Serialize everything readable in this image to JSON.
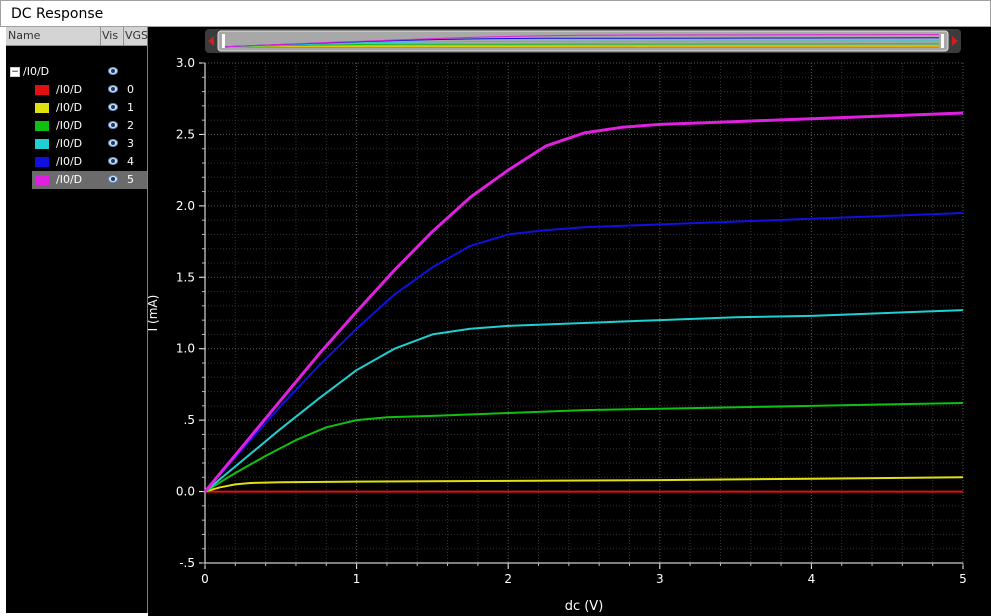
{
  "window": {
    "title": "DC Response"
  },
  "panel": {
    "columns": [
      "Name",
      "Vis",
      "VGS"
    ],
    "parent": {
      "label": "/I0/D"
    },
    "rows": [
      {
        "label": "/I0/D",
        "vgs": "0",
        "color": "#e01010"
      },
      {
        "label": "/I0/D",
        "vgs": "1",
        "color": "#e0e010"
      },
      {
        "label": "/I0/D",
        "vgs": "2",
        "color": "#10c010"
      },
      {
        "label": "/I0/D",
        "vgs": "3",
        "color": "#20d0d0"
      },
      {
        "label": "/I0/D",
        "vgs": "4",
        "color": "#1010e0"
      },
      {
        "label": "/I0/D",
        "vgs": "5",
        "color": "#e020e0"
      }
    ],
    "selected_row": 5
  },
  "chart_data": {
    "type": "line",
    "xlabel": "dc (V)",
    "ylabel": "I (mA)",
    "xlim": [
      0,
      5
    ],
    "ylim": [
      -0.5,
      3.0
    ],
    "xticks": [
      "0",
      "1",
      "2",
      "3",
      "4",
      "5"
    ],
    "yticks": [
      "-.5",
      "0.0",
      ".5",
      "1.0",
      "1.5",
      "2.0",
      "2.5",
      "3.0"
    ],
    "ytick_values": [
      -0.5,
      0,
      0.5,
      1.0,
      1.5,
      2.0,
      2.5,
      3.0
    ],
    "grid": true,
    "series": [
      {
        "name": "0",
        "color": "#e01010",
        "x": [
          0,
          1,
          2,
          3,
          4,
          5
        ],
        "y": [
          0,
          0,
          0,
          0,
          0,
          0
        ]
      },
      {
        "name": "1",
        "color": "#e0e010",
        "x": [
          0,
          0.1,
          0.2,
          0.3,
          0.5,
          1,
          2,
          3,
          4,
          5
        ],
        "y": [
          0,
          0.03,
          0.05,
          0.06,
          0.065,
          0.07,
          0.075,
          0.08,
          0.09,
          0.1
        ]
      },
      {
        "name": "2",
        "color": "#10c010",
        "x": [
          0,
          0.2,
          0.4,
          0.6,
          0.8,
          1.0,
          1.2,
          1.5,
          2,
          2.5,
          3,
          3.5,
          4,
          4.5,
          5
        ],
        "y": [
          0,
          0.13,
          0.25,
          0.36,
          0.45,
          0.5,
          0.52,
          0.53,
          0.55,
          0.57,
          0.58,
          0.59,
          0.6,
          0.61,
          0.62
        ]
      },
      {
        "name": "3",
        "color": "#20d0d0",
        "x": [
          0,
          0.25,
          0.5,
          0.75,
          1.0,
          1.25,
          1.5,
          1.75,
          2,
          2.5,
          3,
          3.5,
          4,
          4.5,
          5
        ],
        "y": [
          0,
          0.22,
          0.44,
          0.65,
          0.85,
          1.0,
          1.1,
          1.14,
          1.16,
          1.18,
          1.2,
          1.22,
          1.23,
          1.25,
          1.27
        ]
      },
      {
        "name": "4",
        "color": "#1010e0",
        "x": [
          0,
          0.25,
          0.5,
          0.75,
          1.0,
          1.25,
          1.5,
          1.75,
          2.0,
          2.25,
          2.5,
          3,
          3.5,
          4,
          4.5,
          5
        ],
        "y": [
          0,
          0.3,
          0.6,
          0.88,
          1.14,
          1.38,
          1.57,
          1.72,
          1.8,
          1.83,
          1.85,
          1.87,
          1.89,
          1.91,
          1.93,
          1.95
        ]
      },
      {
        "name": "5",
        "color": "#e020e0",
        "x": [
          0,
          0.25,
          0.5,
          0.75,
          1.0,
          1.25,
          1.5,
          1.75,
          2.0,
          2.25,
          2.5,
          2.75,
          3,
          3.5,
          4,
          4.5,
          5
        ],
        "y": [
          0,
          0.32,
          0.64,
          0.96,
          1.26,
          1.55,
          1.82,
          2.06,
          2.25,
          2.42,
          2.51,
          2.55,
          2.57,
          2.59,
          2.61,
          2.63,
          2.65
        ]
      }
    ]
  }
}
